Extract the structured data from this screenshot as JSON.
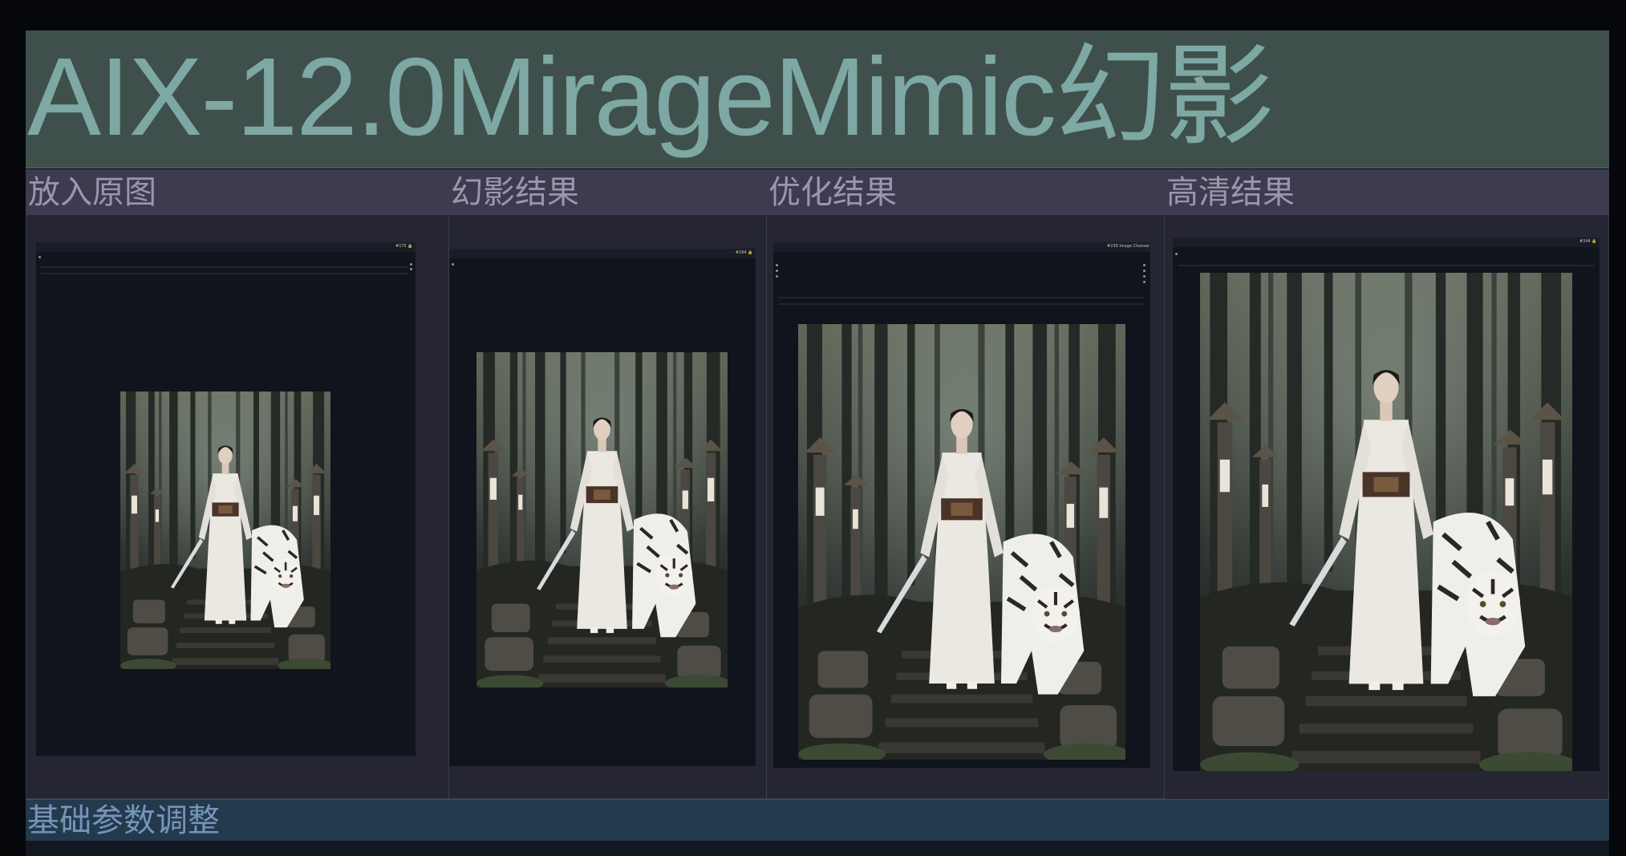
{
  "app": {
    "title": "AIX-12.0MirageMimic幻影"
  },
  "groups": [
    {
      "title": "放入原图",
      "node_label": "#175 🔒"
    },
    {
      "title": "幻影结果",
      "node_label": "#164 🔒"
    },
    {
      "title": "优化结果",
      "node_label": "#239 Image Chooser"
    },
    {
      "title": "高清结果",
      "node_label": "#244 🔒"
    }
  ],
  "footer": {
    "title": "基础参数调整"
  },
  "colors": {
    "title_bg": "#3f504c",
    "title_text": "#7da8a3",
    "group_header": "#3c3b4f",
    "group_title": "#9a96ad",
    "footer_bg": "#23394c",
    "footer_text": "#7595b8"
  }
}
